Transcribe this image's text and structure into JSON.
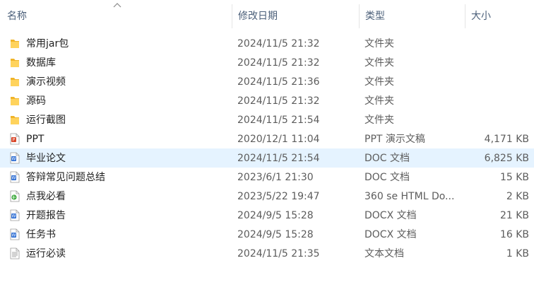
{
  "columns": {
    "name": "名称",
    "date": "修改日期",
    "type": "类型",
    "size": "大小"
  },
  "colors": {
    "header_text": "#4c607a",
    "selection": "#e5f3ff",
    "folder": "#f8c43c"
  },
  "files": [
    {
      "name": "常用jar包",
      "date": "2024/11/5 21:32",
      "type": "文件夹",
      "size": "",
      "icon": "folder-icon"
    },
    {
      "name": "数据库",
      "date": "2024/11/5 21:32",
      "type": "文件夹",
      "size": "",
      "icon": "folder-icon"
    },
    {
      "name": "演示视频",
      "date": "2024/11/5 21:36",
      "type": "文件夹",
      "size": "",
      "icon": "folder-icon"
    },
    {
      "name": "源码",
      "date": "2024/11/5 21:32",
      "type": "文件夹",
      "size": "",
      "icon": "folder-icon"
    },
    {
      "name": "运行截图",
      "date": "2024/11/5 21:54",
      "type": "文件夹",
      "size": "",
      "icon": "folder-icon"
    },
    {
      "name": "PPT",
      "date": "2020/12/1 11:04",
      "type": "PPT 演示文稿",
      "size": "4,171 KB",
      "icon": "ppt-file-icon"
    },
    {
      "name": "毕业论文",
      "date": "2024/11/5 21:54",
      "type": "DOC 文档",
      "size": "6,825 KB",
      "icon": "word-doc-icon",
      "selected": true
    },
    {
      "name": "答辩常见问题总结",
      "date": "2023/6/1 21:30",
      "type": "DOC 文档",
      "size": "15 KB",
      "icon": "word-doc-icon"
    },
    {
      "name": "点我必看",
      "date": "2023/5/22 19:47",
      "type": "360 se HTML Do...",
      "size": "2 KB",
      "icon": "html-file-icon"
    },
    {
      "name": "开题报告",
      "date": "2024/9/5 15:28",
      "type": "DOCX 文档",
      "size": "21 KB",
      "icon": "word-doc-icon"
    },
    {
      "name": "任务书",
      "date": "2024/9/5 15:28",
      "type": "DOCX 文档",
      "size": "16 KB",
      "icon": "word-doc-icon"
    },
    {
      "name": "运行必读",
      "date": "2024/11/5 21:35",
      "type": "文本文档",
      "size": "1 KB",
      "icon": "text-file-icon"
    }
  ]
}
